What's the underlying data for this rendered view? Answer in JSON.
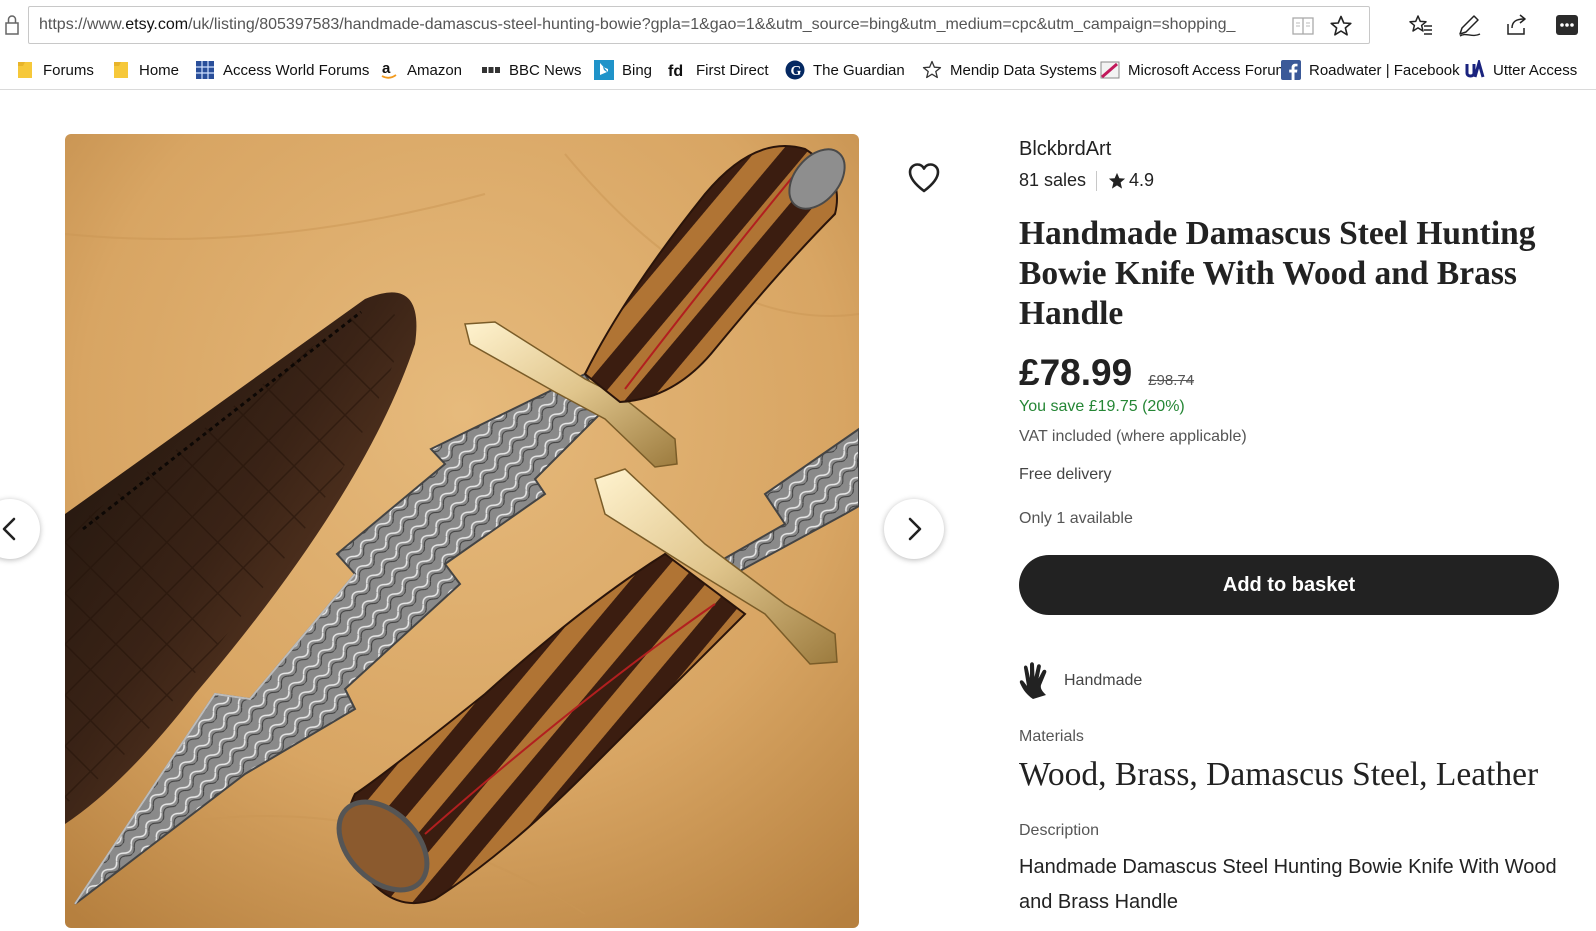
{
  "browser": {
    "url_prefix": "https://www.",
    "url_domain": "etsy.com",
    "url_rest": "/uk/listing/805397583/handmade-damascus-steel-hunting-bowie?gpla=1&gao=1&&utm_source=bing&utm_medium=cpc&utm_campaign=shopping_",
    "toolbar_icons": [
      "favorites-icon",
      "notes-pen-icon",
      "share-icon",
      "more-options-icon"
    ]
  },
  "bookmarks": [
    {
      "label": "Forums",
      "icon": "folder-icon"
    },
    {
      "label": "Home",
      "icon": "folder-icon"
    },
    {
      "label": "Access World Forums",
      "icon": "grid-icon"
    },
    {
      "label": "Amazon",
      "icon": "amazon-icon"
    },
    {
      "label": "BBC News",
      "icon": "bbc-icon"
    },
    {
      "label": "Bing",
      "icon": "bing-icon"
    },
    {
      "label": "First Direct",
      "icon": "fd-icon"
    },
    {
      "label": "The Guardian",
      "icon": "guardian-icon"
    },
    {
      "label": "Mendip Data Systems",
      "icon": "star-outline-icon"
    },
    {
      "label": "Microsoft Access Forum",
      "icon": "image-icon"
    },
    {
      "label": "Roadwater | Facebook",
      "icon": "facebook-icon"
    },
    {
      "label": "Utter Access",
      "icon": "ua-icon"
    }
  ],
  "listing": {
    "shop_name": "BlckbrdArt",
    "sales": "81 sales",
    "rating": "4.9",
    "title": "Handmade Damascus Steel Hunting Bowie Knife With Wood and Brass Handle",
    "price": "£78.99",
    "original_price": "£98.74",
    "savings": "You save £19.75 (20%)",
    "vat_note": "VAT included (where applicable)",
    "delivery": "Free delivery",
    "availability": "Only 1 available",
    "add_to_basket_label": "Add to basket",
    "handmade_label": "Handmade",
    "materials_label": "Materials",
    "materials": "Wood, Brass, Damascus Steel, Leather",
    "description_label": "Description",
    "description": "Handmade Damascus Steel Hunting Bowie Knife With Wood and Brass Handle"
  },
  "colors": {
    "accent_button": "#222222",
    "savings_green": "#258635",
    "photo_background": "#d9a663"
  }
}
